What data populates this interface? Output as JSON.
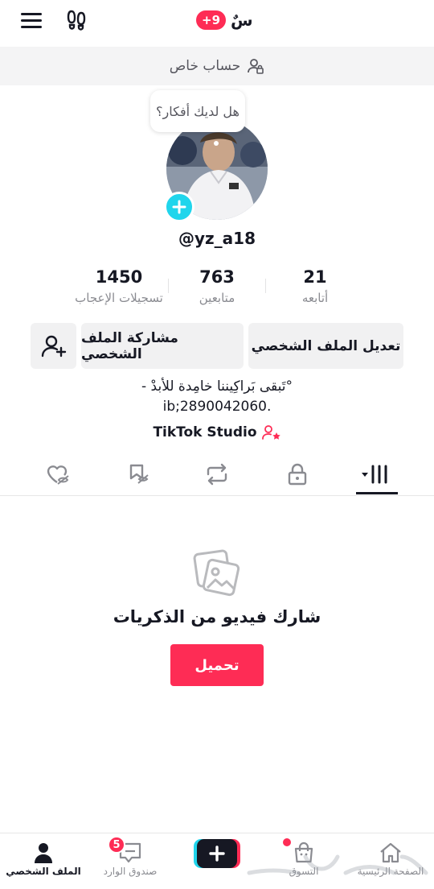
{
  "topbar": {
    "title": "سٌ",
    "notification_badge": "+9"
  },
  "private_account": {
    "label": "حساب خاص"
  },
  "profile": {
    "ideas_bubble": "هل لديك أفكار؟",
    "username": "@yz_a18",
    "stats": [
      {
        "number": "21",
        "label": "أتابعه"
      },
      {
        "number": "763",
        "label": "متابعين"
      },
      {
        "number": "1450",
        "label": "تسجيلات الإعجاب"
      }
    ],
    "buttons": {
      "edit": "تعديل الملف الشخصي",
      "share": "مشاركة الملف الشخصي"
    },
    "bio_line1": "- تَبقى بَراكِيننا خامِدة للأبدْ°",
    "bio_line2": "ib;2890042060.",
    "studio_link": "TikTok Studio"
  },
  "empty_state": {
    "title": "شارك فيديو من الذكريات",
    "upload_button": "تحميل"
  },
  "bottom_nav": {
    "items": [
      {
        "label": "الصفحة الرئيسية",
        "icon": "home-icon"
      },
      {
        "label": "التسوق",
        "icon": "shop-icon"
      },
      {
        "label": "صندوق الوارد",
        "icon": "inbox-icon",
        "badge": "5"
      },
      {
        "label": "الملف الشخصي",
        "icon": "profile-icon"
      }
    ]
  },
  "colors": {
    "accent": "#fe2c55",
    "cyan": "#20d5ec",
    "text": "#161823",
    "muted": "#8a8b91"
  }
}
